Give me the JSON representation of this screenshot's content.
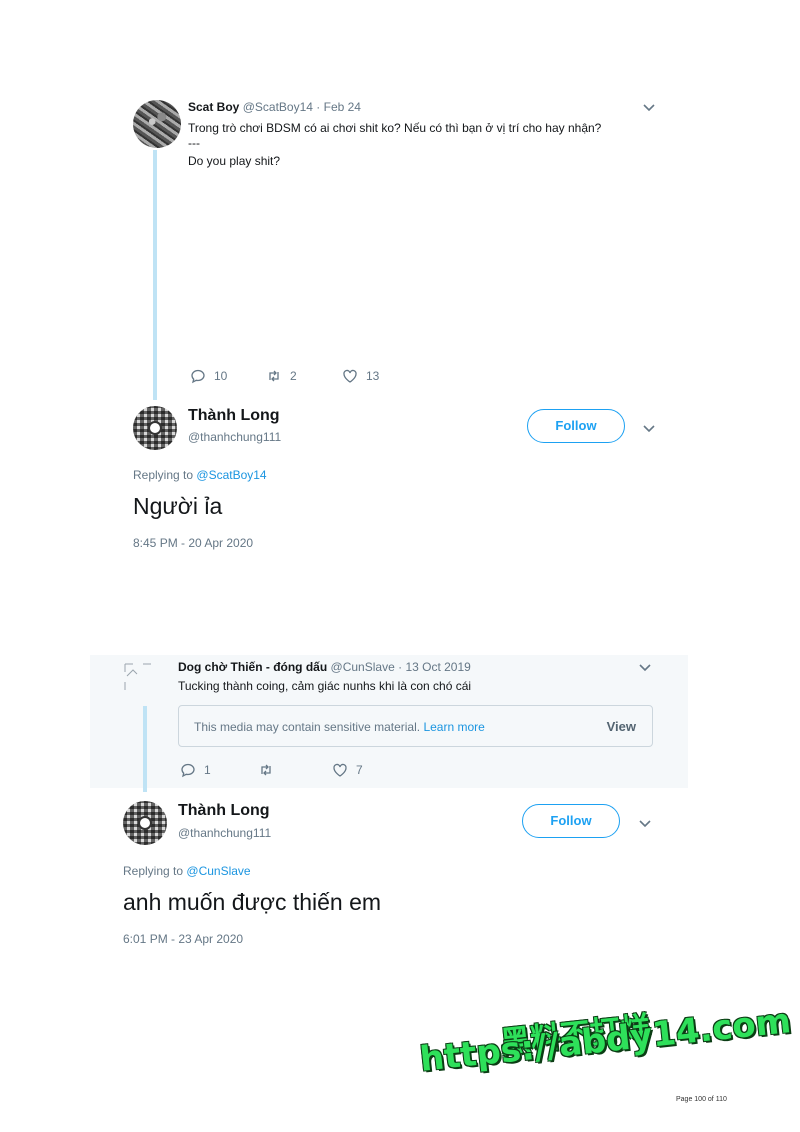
{
  "tweet1": {
    "author_name": "Scat Boy",
    "author_handle": "@ScatBoy14",
    "date": "Feb 24",
    "text_line1": "Trong trò chơi BDSM có ai chơi shit ko? Nếu có thì bạn ở vị trí cho hay nhận?",
    "text_line2": "---",
    "text_line3": "Do you play shit?",
    "replies": "10",
    "retweets": "2",
    "likes": "13"
  },
  "reply1": {
    "author_name": "Thành Long",
    "author_handle": "@thanhchung111",
    "follow_label": "Follow",
    "replying_prefix": "Replying to",
    "replying_to": "@ScatBoy14",
    "text": "Người ỉa",
    "timestamp": "8:45 PM - 20 Apr 2020"
  },
  "tweet2": {
    "author_name": "Dog chờ Thiến - đóng dấu",
    "author_handle": "@CunSlave",
    "date": "13 Oct 2019",
    "text": "Tucking thành coing, cảm giác nunhs khi là con chó cái",
    "sensitive_text": "This media may contain sensitive material.",
    "learn_more": "Learn more",
    "view_label": "View",
    "replies": "1",
    "retweets": "",
    "likes": "7"
  },
  "reply2": {
    "author_name": "Thành Long",
    "author_handle": "@thanhchung111",
    "follow_label": "Follow",
    "replying_prefix": "Replying to",
    "replying_to": "@CunSlave",
    "text": "anh muốn được thiến em",
    "timestamp": "6:01 PM - 23 Apr 2020"
  },
  "watermark": {
    "line1": "黑料不打烊",
    "line2": "https://abdy14.com"
  },
  "page_number": "Page 100 of 110",
  "colors": {
    "link": "#1b95e0",
    "muted": "#657786",
    "thread_line": "#bfe3f5",
    "watermark": "#2ee05a"
  }
}
